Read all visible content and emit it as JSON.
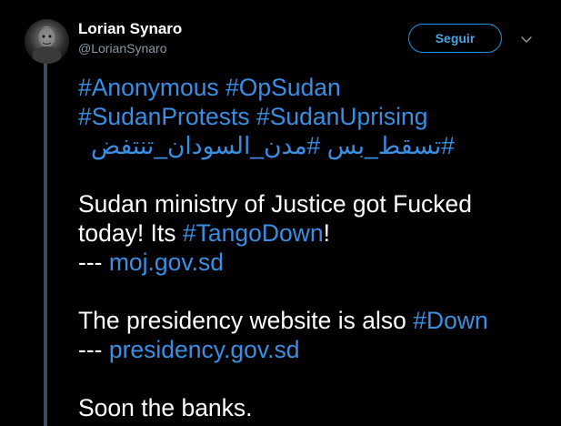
{
  "tweet": {
    "author": {
      "display_name": "Lorian Synaro",
      "handle": "@LorianSynaro"
    },
    "follow_label": "Seguir",
    "line1": {
      "tag1": "#Anonymous",
      "tag2": "#OpSudan"
    },
    "line2": {
      "tag1": "#SudanProtests",
      "tag2": "#SudanUprising"
    },
    "line3": {
      "tag1": "#تسقط_بس",
      "tag2": "#مدن_السودان_تنتفض"
    },
    "para1": {
      "text1": "Sudan ministry of Justice got Fucked",
      "text2": "today! Its ",
      "tag": "#TangoDown",
      "text3": "!",
      "dash": "--- ",
      "link": "moj.gov.sd"
    },
    "para2": {
      "text1": "The presidency website is also ",
      "tag": "#Down",
      "dash": "--- ",
      "link": "presidency.gov.sd"
    },
    "para3": {
      "text1": "Soon the banks."
    }
  },
  "colors": {
    "background": "#000000",
    "text": "#ffffff",
    "link": "#3a8ee3",
    "secondary": "#8899a6",
    "thread_line": "#3d4b5c",
    "button_border": "#1b95e0"
  }
}
